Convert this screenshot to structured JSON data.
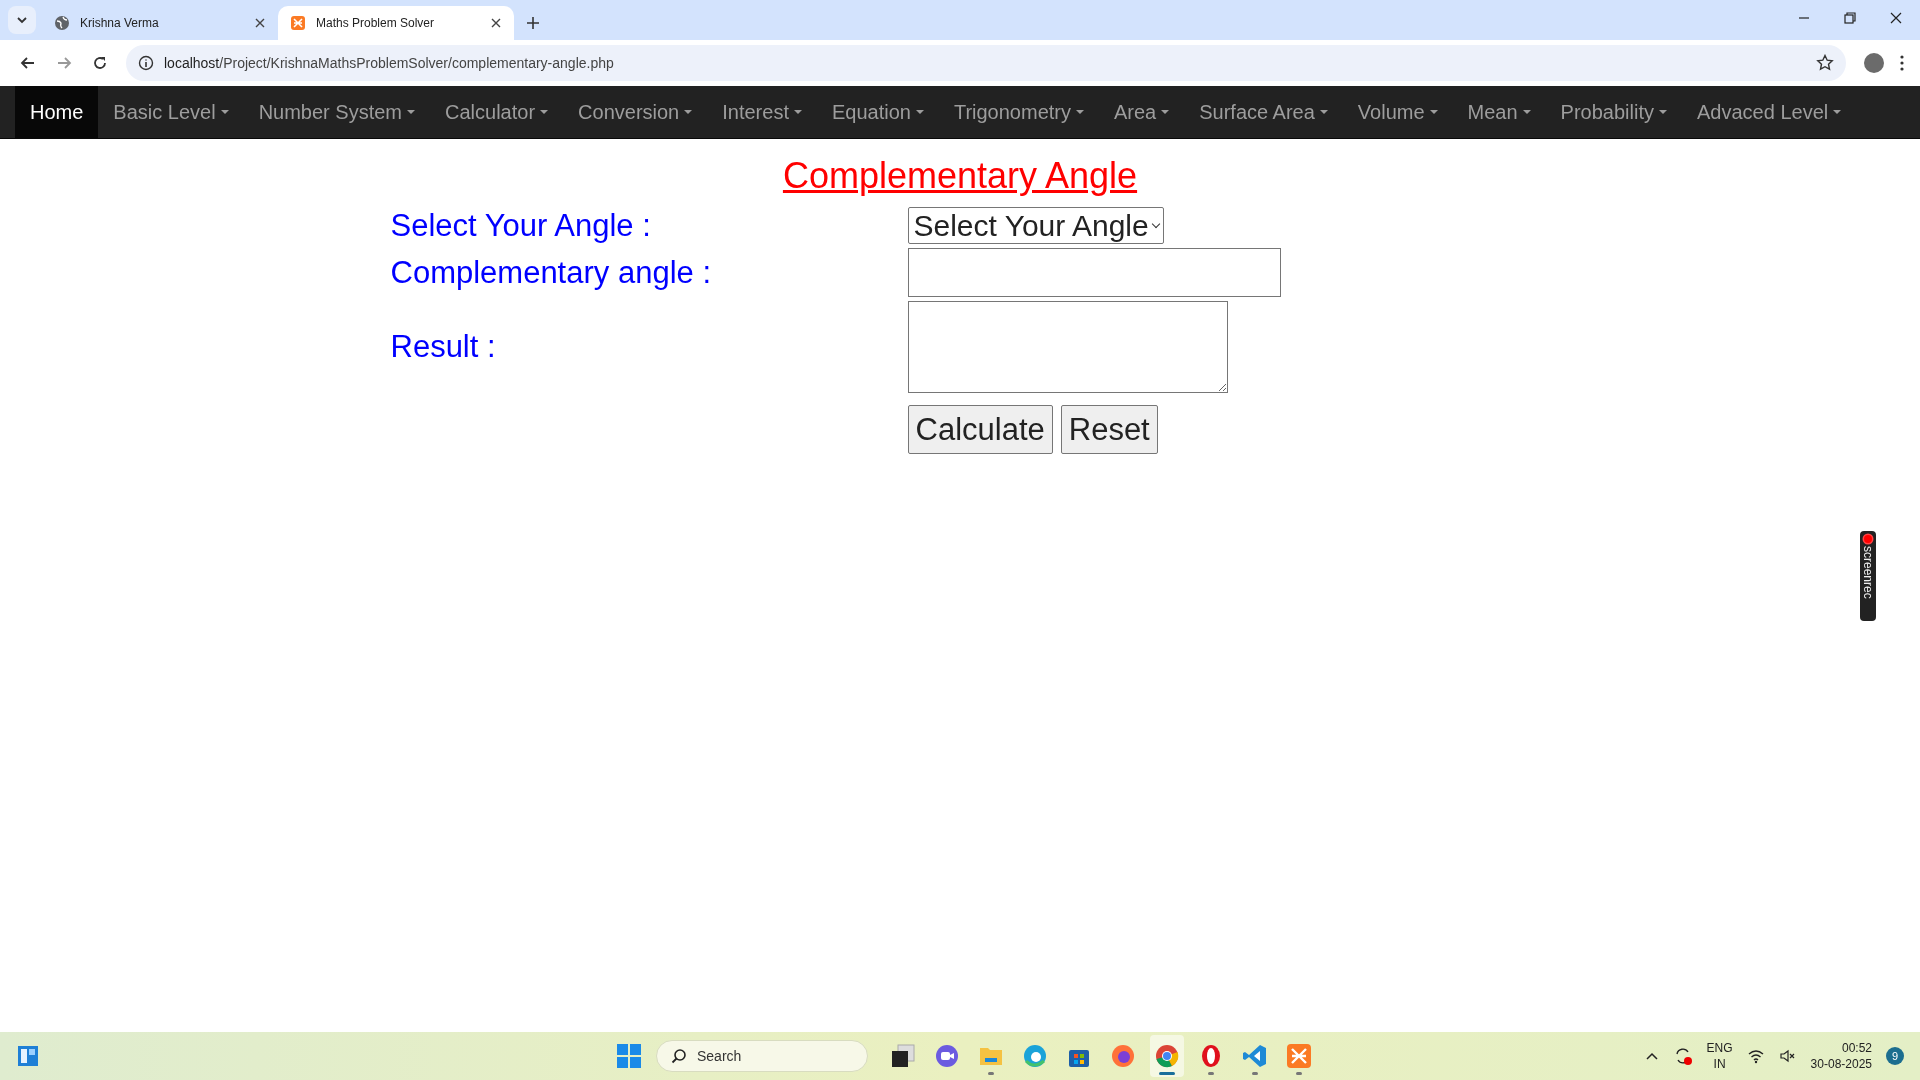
{
  "browser": {
    "tabs": [
      {
        "title": "Krishna Verma",
        "selected": false
      },
      {
        "title": "Maths Problem Solver",
        "selected": true
      }
    ],
    "url_host": "localhost",
    "url_path": "/Project/KrishnaMathsProblemSolver/complementary-angle.php"
  },
  "navbar": {
    "items": [
      {
        "label": "Home",
        "selected": true,
        "dropdown": false
      },
      {
        "label": "Basic Level",
        "selected": false,
        "dropdown": true
      },
      {
        "label": "Number System",
        "selected": false,
        "dropdown": true
      },
      {
        "label": "Calculator",
        "selected": false,
        "dropdown": true
      },
      {
        "label": "Conversion",
        "selected": false,
        "dropdown": true
      },
      {
        "label": "Interest",
        "selected": false,
        "dropdown": true
      },
      {
        "label": "Equation",
        "selected": false,
        "dropdown": true
      },
      {
        "label": "Trigonometry",
        "selected": false,
        "dropdown": true
      },
      {
        "label": "Area",
        "selected": false,
        "dropdown": true
      },
      {
        "label": "Surface Area",
        "selected": false,
        "dropdown": true
      },
      {
        "label": "Volume",
        "selected": false,
        "dropdown": true
      },
      {
        "label": "Mean",
        "selected": false,
        "dropdown": true
      },
      {
        "label": "Probability",
        "selected": false,
        "dropdown": true
      },
      {
        "label": "Advaced Level",
        "selected": false,
        "dropdown": true
      }
    ]
  },
  "form": {
    "title": "Complementary Angle",
    "rows": [
      {
        "label": "Select Your Angle :",
        "kind": "select",
        "value": "Select Your Angle"
      },
      {
        "label": "Complementary angle :",
        "kind": "input"
      },
      {
        "label": "Result :",
        "kind": "textarea"
      }
    ],
    "buttons": [
      "Calculate",
      "Reset"
    ]
  },
  "screenrec": {
    "label": "screenrec"
  },
  "taskbar": {
    "search_placeholder": "Search",
    "apps": [
      {
        "kind": "taskview",
        "running": false,
        "active": false
      },
      {
        "kind": "meet",
        "running": false,
        "active": false
      },
      {
        "kind": "folder",
        "running": true,
        "active": false
      },
      {
        "kind": "edge",
        "running": false,
        "active": false
      },
      {
        "kind": "store",
        "running": false,
        "active": false
      },
      {
        "kind": "firefox",
        "running": false,
        "active": false
      },
      {
        "kind": "chrome",
        "running": true,
        "active": true
      },
      {
        "kind": "opera",
        "running": true,
        "active": false
      },
      {
        "kind": "vscode",
        "running": true,
        "active": false
      },
      {
        "kind": "xampp",
        "running": true,
        "active": false
      }
    ],
    "lang": "ENG",
    "region": "IN",
    "time": "00:52",
    "date": "30-08-2025",
    "notifications": "9"
  }
}
